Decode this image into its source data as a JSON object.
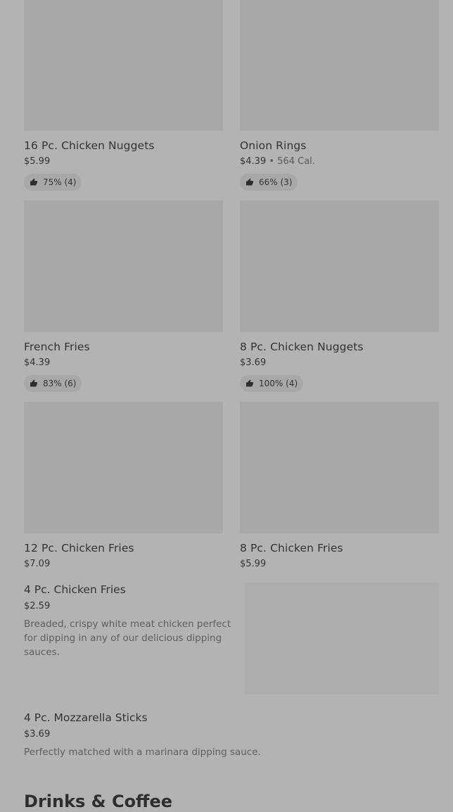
{
  "grid_items": [
    {
      "name": "16 Pc. Chicken Nuggets",
      "price": "$5.99",
      "calories": "",
      "rating": "75% (4)"
    },
    {
      "name": "Onion Rings",
      "price": "$4.39",
      "calories": "564 Cal.",
      "rating": "66% (3)"
    },
    {
      "name": "French Fries",
      "price": "$4.39",
      "calories": "",
      "rating": "83% (6)"
    },
    {
      "name": "8 Pc. Chicken Nuggets",
      "price": "$3.69",
      "calories": "",
      "rating": "100% (4)"
    },
    {
      "name": "12 Pc. Chicken Fries",
      "price": "$7.09",
      "calories": "",
      "rating": ""
    },
    {
      "name": "8 Pc. Chicken Fries",
      "price": "$5.99",
      "calories": "",
      "rating": ""
    }
  ],
  "calorie_separator": "•",
  "list_items": [
    {
      "name": "4 Pc. Chicken Fries",
      "price": "$2.59",
      "description": "Breaded, crispy white meat chicken perfect for dipping in any of our delicious dipping sauces."
    },
    {
      "name": "4 Pc. Mozzarella Sticks",
      "price": "$3.69",
      "description": "Perfectly matched with a marinara dipping sauce."
    }
  ],
  "next_section_title": "Drinks & Coffee",
  "icons": {
    "rating": "thumbs-up-icon"
  }
}
